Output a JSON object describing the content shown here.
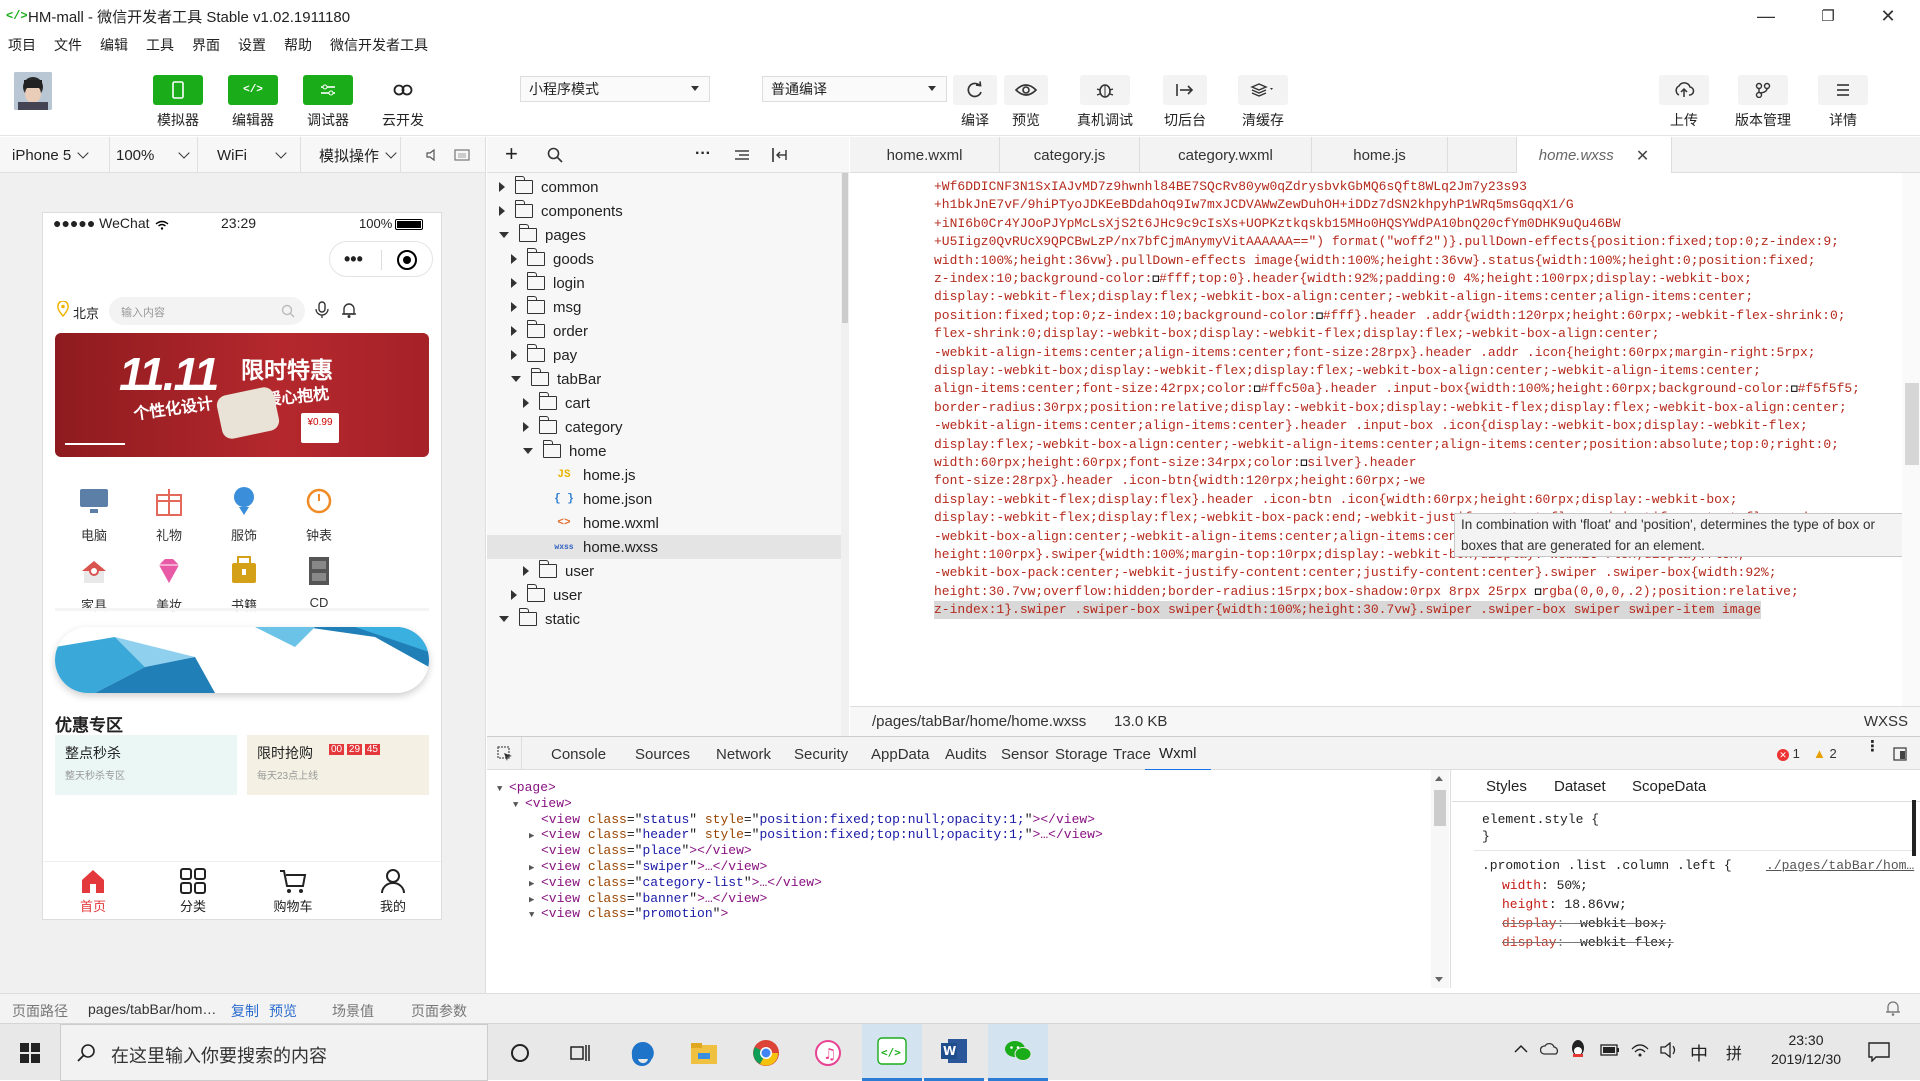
{
  "window": {
    "title": "HM-mall - 微信开发者工具 Stable v1.02.1911180",
    "app_icon": "</>",
    "controls": [
      "—",
      "❐",
      "✕"
    ]
  },
  "menu": [
    "项目",
    "文件",
    "编辑",
    "工具",
    "界面",
    "设置",
    "帮助",
    "微信开发者工具"
  ],
  "toolbar": {
    "left_buttons": [
      {
        "label": "模拟器",
        "icon": "phone-icon"
      },
      {
        "label": "编辑器",
        "icon": "code-icon"
      },
      {
        "label": "调试器",
        "icon": "debug-icon"
      },
      {
        "label": "云开发",
        "icon": "cloud-icon"
      }
    ],
    "mode_select": "小程序模式",
    "compile_select": "普通编译",
    "mid_buttons": [
      {
        "label": "编译",
        "icon": "refresh-icon"
      },
      {
        "label": "预览",
        "icon": "eye-icon"
      },
      {
        "label": "真机调试",
        "icon": "bug-icon"
      },
      {
        "label": "切后台",
        "icon": "switch-icon"
      },
      {
        "label": "清缓存",
        "icon": "layers-icon"
      }
    ],
    "right_buttons": [
      {
        "label": "上传",
        "icon": "upload-icon"
      },
      {
        "label": "版本管理",
        "icon": "branch-icon"
      },
      {
        "label": "详情",
        "icon": "menu-icon"
      }
    ]
  },
  "simulator_bar": {
    "device": "iPhone 5",
    "zoom": "100%",
    "network": "WiFi",
    "ops": "模拟操作"
  },
  "phone": {
    "signal": "●●●●● WeChat",
    "time": "23:29",
    "battery": "100%",
    "location": "北京",
    "search_placeholder": "输入内容",
    "banner": {
      "big": "11.11",
      "line1": "限时特惠",
      "line2": "个性化设计",
      "line3": "暖心抱枕",
      "price": "¥0.99"
    },
    "categories": [
      {
        "label": "电脑",
        "color": "#5b7fa6"
      },
      {
        "label": "礼物",
        "color": "#e36a5a"
      },
      {
        "label": "服饰",
        "color": "#3b8ed9"
      },
      {
        "label": "钟表",
        "color": "#f08a24"
      },
      {
        "label": "家具",
        "color": "#d9534f"
      },
      {
        "label": "美妆",
        "color": "#e85aa6"
      },
      {
        "label": "书籍",
        "color": "#d4a017"
      },
      {
        "label": "CD",
        "color": "#555555"
      }
    ],
    "promo_title": "优惠专区",
    "promo": [
      {
        "title": "整点秒杀",
        "sub": "整天秒杀专区"
      },
      {
        "title": "限时抢购",
        "sub": "每天23点上线",
        "countdown": [
          "00",
          "29",
          "45"
        ]
      }
    ],
    "nav": [
      {
        "label": "首页",
        "icon": "home-icon",
        "active": true
      },
      {
        "label": "分类",
        "icon": "grid-icon"
      },
      {
        "label": "购物车",
        "icon": "cart-icon"
      },
      {
        "label": "我的",
        "icon": "user-icon"
      }
    ]
  },
  "tree": [
    {
      "name": "common",
      "type": "folder",
      "depth": 0,
      "open": false
    },
    {
      "name": "components",
      "type": "folder",
      "depth": 0,
      "open": false
    },
    {
      "name": "pages",
      "type": "folder",
      "depth": 0,
      "open": true
    },
    {
      "name": "goods",
      "type": "folder",
      "depth": 1,
      "open": false
    },
    {
      "name": "login",
      "type": "folder",
      "depth": 1,
      "open": false
    },
    {
      "name": "msg",
      "type": "folder",
      "depth": 1,
      "open": false
    },
    {
      "name": "order",
      "type": "folder",
      "depth": 1,
      "open": false
    },
    {
      "name": "pay",
      "type": "folder",
      "depth": 1,
      "open": false
    },
    {
      "name": "tabBar",
      "type": "folder",
      "depth": 1,
      "open": true
    },
    {
      "name": "cart",
      "type": "folder",
      "depth": 2,
      "open": false
    },
    {
      "name": "category",
      "type": "folder",
      "depth": 2,
      "open": false
    },
    {
      "name": "home",
      "type": "folder",
      "depth": 2,
      "open": true
    },
    {
      "name": "home.js",
      "type": "file",
      "depth": 3,
      "badge": "JS",
      "badge_color": "#e8b400"
    },
    {
      "name": "home.json",
      "type": "file",
      "depth": 3,
      "badge": "{ }",
      "badge_color": "#2b7cd3"
    },
    {
      "name": "home.wxml",
      "type": "file",
      "depth": 3,
      "badge": "<>",
      "badge_color": "#e06c2b"
    },
    {
      "name": "home.wxss",
      "type": "file",
      "depth": 3,
      "badge": "wxss",
      "badge_color": "#3060c0",
      "selected": true
    },
    {
      "name": "user",
      "type": "folder",
      "depth": 2,
      "open": false
    },
    {
      "name": "user",
      "type": "folder",
      "depth": 1,
      "open": false
    },
    {
      "name": "static",
      "type": "folder",
      "depth": 0,
      "open": true
    }
  ],
  "editor_tabs": [
    "home.wxml",
    "category.js",
    "category.wxml",
    "home.js",
    "home.wxss"
  ],
  "code_lines": [
    "+Wf6DDICNF3N1SxIAJvMD7z9hwnhl84BE7SQcRv80yw0qZdrysbvkGbMQ6sQft8WLq2Jm7y23s93",
    "+h1bkJnE7vF/9hiPTyoJDKEeBDdahOq9Iw7mxJCDVAWwZewDuhOH+iDDz7dSN2khpyhP1WRq5msGqqX1/G",
    "+iNI6b0Cr4YJOoPJYpMcLsXjS2t6JHc9c9cIsXs+UOPKztkqskb15MHo0HQSYWdPA10bnQ20cfYm0DHK9uQu46BW",
    "+U5Iigz0QvRUcX9QPCBwLzP/nx7bfCjmAnymyVitAAAAAA==\") format(\"woff2\")}.pullDown-effects{position:fixed;top:0;z-index:9;",
    "width:100%;height:36vw}.pullDown-effects image{width:100%;height:36vw}.status{width:100%;height:0;position:fixed;",
    "z-index:10;background-color:■#fff;top:0}.header{width:92%;padding:0 4%;height:100rpx;display:-webkit-box;",
    "display:-webkit-flex;display:flex;-webkit-box-align:center;-webkit-align-items:center;align-items:center;",
    "position:fixed;top:0;z-index:10;background-color:■#fff}.header .addr{width:120rpx;height:60rpx;-webkit-flex-shrink:0;",
    "flex-shrink:0;display:-webkit-box;display:-webkit-flex;display:flex;-webkit-box-align:center;",
    "-webkit-align-items:center;align-items:center;font-size:28rpx}.header .addr .icon{height:60rpx;margin-right:5rpx;",
    "display:-webkit-box;display:-webkit-flex;display:flex;-webkit-box-align:center;-webkit-align-items:center;",
    "align-items:center;font-size:42rpx;color:■#ffc50a}.header .input-box{width:100%;height:60rpx;background-color:■#f5f5f5;",
    "border-radius:30rpx;position:relative;display:-webkit-box;display:-webkit-flex;display:flex;-webkit-box-align:center;",
    "-webkit-align-items:center;align-items:center}.header .input-box .icon{display:-webkit-box;display:-webkit-flex;",
    "display:flex;-webkit-box-align:center;-webkit-align-items:center;align-items:center;position:absolute;top:0;right:0;",
    "width:60rpx;height:60rpx;font-size:34rpx;color:■silver}.header",
    "font-size:28rpx}.header .icon-btn{width:120rpx;height:60rpx;-we",
    "display:-webkit-flex;display:flex}.header .icon-btn .icon{width:60rpx;height:60rpx;display:-webkit-box;",
    "display:-webkit-flex;display:flex;-webkit-box-pack:end;-webkit-justify-content:flex-end;justify-content:flex-end;",
    "-webkit-box-align:center;-webkit-align-items:center;align-items:center;font-size:42rpx}.place{background-color:■#fff;",
    "height:100rpx}.swiper{width:100%;margin-top:10rpx;display:-webkit-box;display:-webkit-flex;display:flex;",
    "-webkit-box-pack:center;-webkit-justify-content:center;justify-content:center}.swiper .swiper-box{width:92%;",
    "height:30.7vw;overflow:hidden;border-radius:15rpx;box-shadow:0rpx 8rpx 25rpx ■rgba(0,0,0,.2);position:relative;",
    "z-index:1}.swiper .swiper-box swiper{width:100%;height:30.7vw}.swiper .swiper-box swiper swiper-item image"
  ],
  "tooltip": "In combination with 'float' and 'position', determines the type of box or boxes that are generated for an element.",
  "editor_status": {
    "path": "/pages/tabBar/home/home.wxss",
    "size": "13.0 KB",
    "lang": "WXSS"
  },
  "devtools": {
    "tabs": [
      "Console",
      "Sources",
      "Network",
      "Security",
      "AppData",
      "Audits",
      "Sensor",
      "Storage",
      "Trace",
      "Wxml"
    ],
    "active": "Wxml",
    "errors": "1",
    "warnings": "2"
  },
  "wxml_lines": [
    {
      "indent": 0,
      "tw": "▼",
      "tag": "page",
      "attrs": [],
      "close": "",
      "open": true
    },
    {
      "indent": 1,
      "tw": "▼",
      "tag": "view",
      "attrs": [],
      "close": "",
      "open": true
    },
    {
      "indent": 2,
      "tw": "",
      "tag": "view",
      "attrs": [
        [
          "class",
          "status"
        ],
        [
          "style",
          "position:fixed;top:null;opacity:1;"
        ]
      ],
      "close": "</view>"
    },
    {
      "indent": 2,
      "tw": "▶",
      "tag": "view",
      "attrs": [
        [
          "class",
          "header"
        ],
        [
          "style",
          "position:fixed;top:null;opacity:1;"
        ]
      ],
      "close": "…</view>"
    },
    {
      "indent": 2,
      "tw": "",
      "tag": "view",
      "attrs": [
        [
          "class",
          "place"
        ]
      ],
      "close": "</view>"
    },
    {
      "indent": 2,
      "tw": "▶",
      "tag": "view",
      "attrs": [
        [
          "class",
          "swiper"
        ]
      ],
      "close": "…</view>"
    },
    {
      "indent": 2,
      "tw": "▶",
      "tag": "view",
      "attrs": [
        [
          "class",
          "category-list"
        ]
      ],
      "close": "…</view>"
    },
    {
      "indent": 2,
      "tw": "▶",
      "tag": "view",
      "attrs": [
        [
          "class",
          "banner"
        ]
      ],
      "close": "…</view>"
    },
    {
      "indent": 2,
      "tw": "▼",
      "tag": "view",
      "attrs": [
        [
          "class",
          "promotion"
        ]
      ],
      "close": ""
    }
  ],
  "styles_panel": {
    "tabs": [
      "Styles",
      "Dataset",
      "ScopeData"
    ],
    "element_style": "element.style {",
    "close_brace": "}",
    "rule_selector": ".promotion .list .column .left {",
    "rule_link": "./pages/tabBar/hom…",
    "props": [
      {
        "name": "width",
        "value": "50%;",
        "struck": false
      },
      {
        "name": "height",
        "value": "18.86vw;",
        "struck": false
      },
      {
        "name": "display",
        "value": "-webkit-box;",
        "struck": true
      },
      {
        "name": "display",
        "value": "-webkit-flex;",
        "struck": true
      }
    ]
  },
  "bottombar": {
    "path_label": "页面路径",
    "path": "pages/tabBar/hom…",
    "copy": "复制",
    "preview": "预览",
    "scene": "场景值",
    "params": "页面参数"
  },
  "taskbar": {
    "search_placeholder": "在这里输入你要搜索的内容",
    "time": "23:30",
    "date": "2019/12/30",
    "ime": "中",
    "ime2": "拼"
  }
}
